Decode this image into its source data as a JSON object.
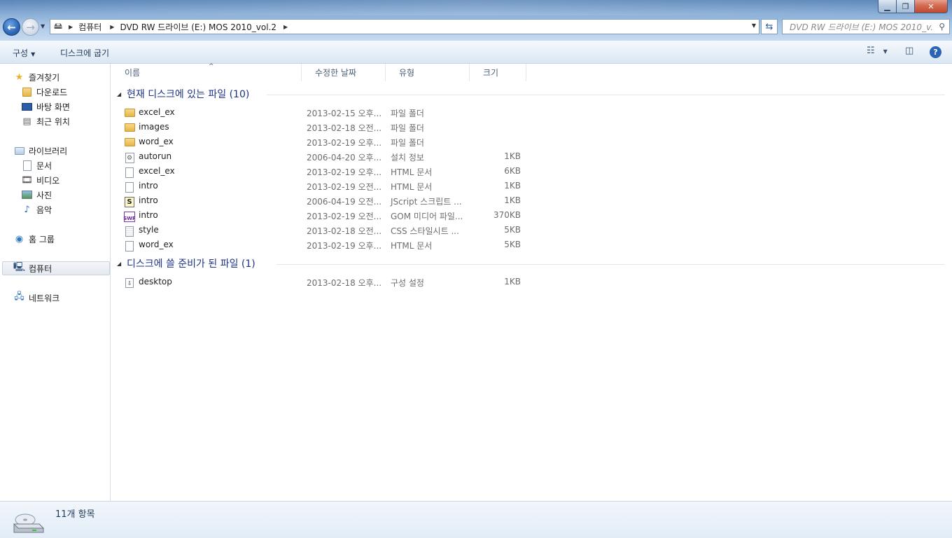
{
  "window": {
    "controls": {
      "minimize": "▁",
      "maximize": "❐",
      "close": "✕"
    }
  },
  "address_bar": {
    "breadcrumbs": [
      "컴퓨터",
      "DVD RW 드라이브 (E:) MOS 2010_vol.2"
    ]
  },
  "search": {
    "placeholder": "DVD RW 드라이브 (E:) MOS 2010_v..."
  },
  "command_bar": {
    "organize_label": "구성",
    "burn_label": "디스크에 굽기"
  },
  "nav_pane": {
    "favorites_label": "즐겨찾기",
    "favorites": [
      "다운로드",
      "바탕 화면",
      "최근 위치"
    ],
    "libraries_label": "라이브러리",
    "libraries": [
      "문서",
      "비디오",
      "사진",
      "음악"
    ],
    "homegroup_label": "홈 그룹",
    "computer_label": "컴퓨터",
    "network_label": "네트워크"
  },
  "columns": {
    "name": "이름",
    "modified": "수정한 날짜",
    "type": "유형",
    "size": "크기"
  },
  "groups": [
    {
      "title": "현재 디스크에 있는 파일 (10)",
      "files": [
        {
          "icon": "folder-icon",
          "name": "excel_ex",
          "date": "2013-02-15 오후...",
          "type": "파일 폴더",
          "size": ""
        },
        {
          "icon": "folder-icon",
          "name": "images",
          "date": "2013-02-18 오전...",
          "type": "파일 폴더",
          "size": ""
        },
        {
          "icon": "folder-icon",
          "name": "word_ex",
          "date": "2013-02-19 오후...",
          "type": "파일 폴더",
          "size": ""
        },
        {
          "icon": "setup-info-icon",
          "name": "autorun",
          "date": "2006-04-20 오후...",
          "type": "설치 정보",
          "size": "1KB"
        },
        {
          "icon": "html-document-icon",
          "name": "excel_ex",
          "date": "2013-02-19 오후...",
          "type": "HTML 문서",
          "size": "6KB"
        },
        {
          "icon": "html-document-icon",
          "name": "intro",
          "date": "2013-02-19 오전...",
          "type": "HTML 문서",
          "size": "1KB"
        },
        {
          "icon": "jscript-icon",
          "name": "intro",
          "date": "2006-04-19 오전...",
          "type": "JScript 스크립트 ...",
          "size": "1KB"
        },
        {
          "icon": "swf-icon",
          "name": "intro",
          "date": "2013-02-19 오전...",
          "type": "GOM 미디어 파일...",
          "size": "370KB"
        },
        {
          "icon": "css-document-icon",
          "name": "style",
          "date": "2013-02-18 오전...",
          "type": "CSS 스타일시트 ...",
          "size": "5KB"
        },
        {
          "icon": "html-document-icon",
          "name": "word_ex",
          "date": "2013-02-19 오후...",
          "type": "HTML 문서",
          "size": "5KB"
        }
      ]
    },
    {
      "title": "디스크에 쓸 준비가 된 파일 (1)",
      "files": [
        {
          "icon": "config-file-icon",
          "name": "desktop",
          "date": "2013-02-18 오후...",
          "type": "구성 설정",
          "size": "1KB"
        }
      ]
    }
  ],
  "status": {
    "item_count": "11개 항목"
  }
}
